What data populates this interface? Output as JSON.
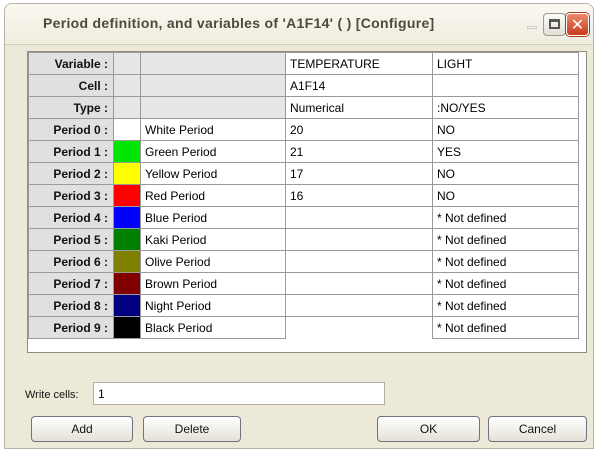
{
  "window": {
    "title": "Period definition, and variables of 'A1F14' ( ) [Configure]"
  },
  "grid": {
    "variables": [
      "TEMPERATURE",
      "LIGHT"
    ],
    "header_rows": [
      {
        "label": "Variable :",
        "values": [
          "TEMPERATURE",
          "LIGHT"
        ]
      },
      {
        "label": "Cell :",
        "values": [
          "A1F14",
          ""
        ]
      },
      {
        "label": "Type :",
        "values": [
          "Numerical",
          ":NO/YES"
        ]
      }
    ],
    "periods": [
      {
        "label": "Period 0 :",
        "name": "White Period",
        "color": "#ffffff",
        "temperature": "20",
        "light": "NO"
      },
      {
        "label": "Period 1 :",
        "name": "Green Period",
        "color": "#00e600",
        "temperature": "21",
        "light": "YES"
      },
      {
        "label": "Period 2 :",
        "name": "Yellow Period",
        "color": "#ffff00",
        "temperature": "17",
        "light": "NO"
      },
      {
        "label": "Period 3 :",
        "name": "Red Period",
        "color": "#ff0000",
        "temperature": "16",
        "light": "NO"
      },
      {
        "label": "Period 4 :",
        "name": "Blue Period",
        "color": "#0000ff",
        "temperature": "",
        "light": "* Not defined"
      },
      {
        "label": "Period 5 :",
        "name": "Kaki Period",
        "color": "#008000",
        "temperature": "",
        "light": "* Not defined"
      },
      {
        "label": "Period 6 :",
        "name": "Olive Period",
        "color": "#808000",
        "temperature": "",
        "light": "* Not defined"
      },
      {
        "label": "Period 7 :",
        "name": "Brown Period",
        "color": "#800000",
        "temperature": "",
        "light": "* Not defined"
      },
      {
        "label": "Period 8 :",
        "name": "Night Period",
        "color": "#000080",
        "temperature": "",
        "light": "* Not defined"
      },
      {
        "label": "Period 9 :",
        "name": "Black Period",
        "color": "#000000",
        "temperature": "",
        "light": "* Not defined"
      }
    ]
  },
  "write_cells": {
    "label": "Write cells:",
    "value": "1"
  },
  "buttons": {
    "add": "Add",
    "delete": "Delete",
    "ok": "OK",
    "cancel": "Cancel"
  },
  "icons": {
    "minimize": "minimize-icon",
    "maximize": "maximize-icon",
    "close": "close-icon"
  }
}
